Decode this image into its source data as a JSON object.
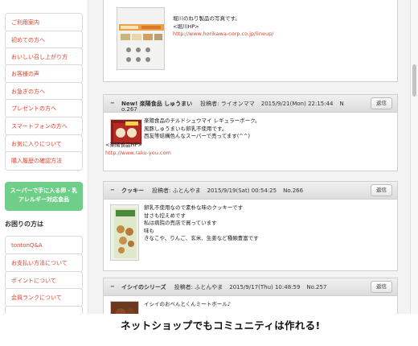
{
  "sidebar": {
    "items": [
      {
        "label": "ご利用案内"
      },
      {
        "label": "初めての方へ"
      },
      {
        "label": "おいしい召し上がり方"
      },
      {
        "label": "お客様の声"
      },
      {
        "label": "お急ぎの方へ"
      },
      {
        "label": "プレゼントの方へ"
      },
      {
        "label": "スマートフォンの方へ"
      },
      {
        "label": "お気に入りについて"
      },
      {
        "label": "購入履歴の確認方法"
      }
    ],
    "promo_line1": "スーパーで手に入る卵・乳",
    "promo_line2": "アレルギー対応食品",
    "help_heading": "お困りの方は",
    "help_items": [
      {
        "label": "tontonQ&A"
      },
      {
        "label": "お支払い方法について"
      },
      {
        "label": "ポイントについて"
      },
      {
        "label": "会員ランクについて"
      }
    ]
  },
  "posts": [
    {
      "body_lines": [
        "堀川のねり製品の写真です。",
        "<堀川HP>"
      ],
      "link": "http://www.horikawa-corp.co.jp/lineup/"
    },
    {
      "title": "New! 楽陽食品 しゅうまい",
      "poster": "投稿者: ライオンママ",
      "date": "2015/9/21(Mon) 22:15:44",
      "number_part1": "N",
      "number_part2": "o.267",
      "reply": "返信",
      "body_lines": [
        "楽陽食品のチルドシュウマイ レギュラーポーク。",
        "風豚しゅうまいも卵乳不使用です。",
        "西友等結構色んなスーパーで売ってます(^^)"
      ],
      "body_after_photo": "<楽陽食品HP>",
      "link": "http://www.raku-you.com"
    },
    {
      "title": "クッキー",
      "poster": "投稿者: ふとんやま",
      "date": "2015/9/19(Sat) 00:54:25",
      "number": "No.266",
      "reply": "返信",
      "body_lines": [
        "卵乳不使用なので素朴な味のクッキーです",
        "甘さも控えめです",
        "私は病院の売店で買っています",
        "味も",
        "きなこや、りんご、玄米、生姜など種類豊富です"
      ]
    },
    {
      "title": "イシイのシリーズ",
      "poster": "投稿者: ふとんやま",
      "date": "2015/9/17(Thu) 10:48:59",
      "number": "No.257",
      "reply": "返信",
      "body_lines": [
        "イシイのおべんとくんミートボール♪"
      ]
    }
  ],
  "banner": "ネットショップでもコミュニティは作れる!",
  "colors": {
    "accent": "#e0402a",
    "promo": "#6fcf8a"
  }
}
